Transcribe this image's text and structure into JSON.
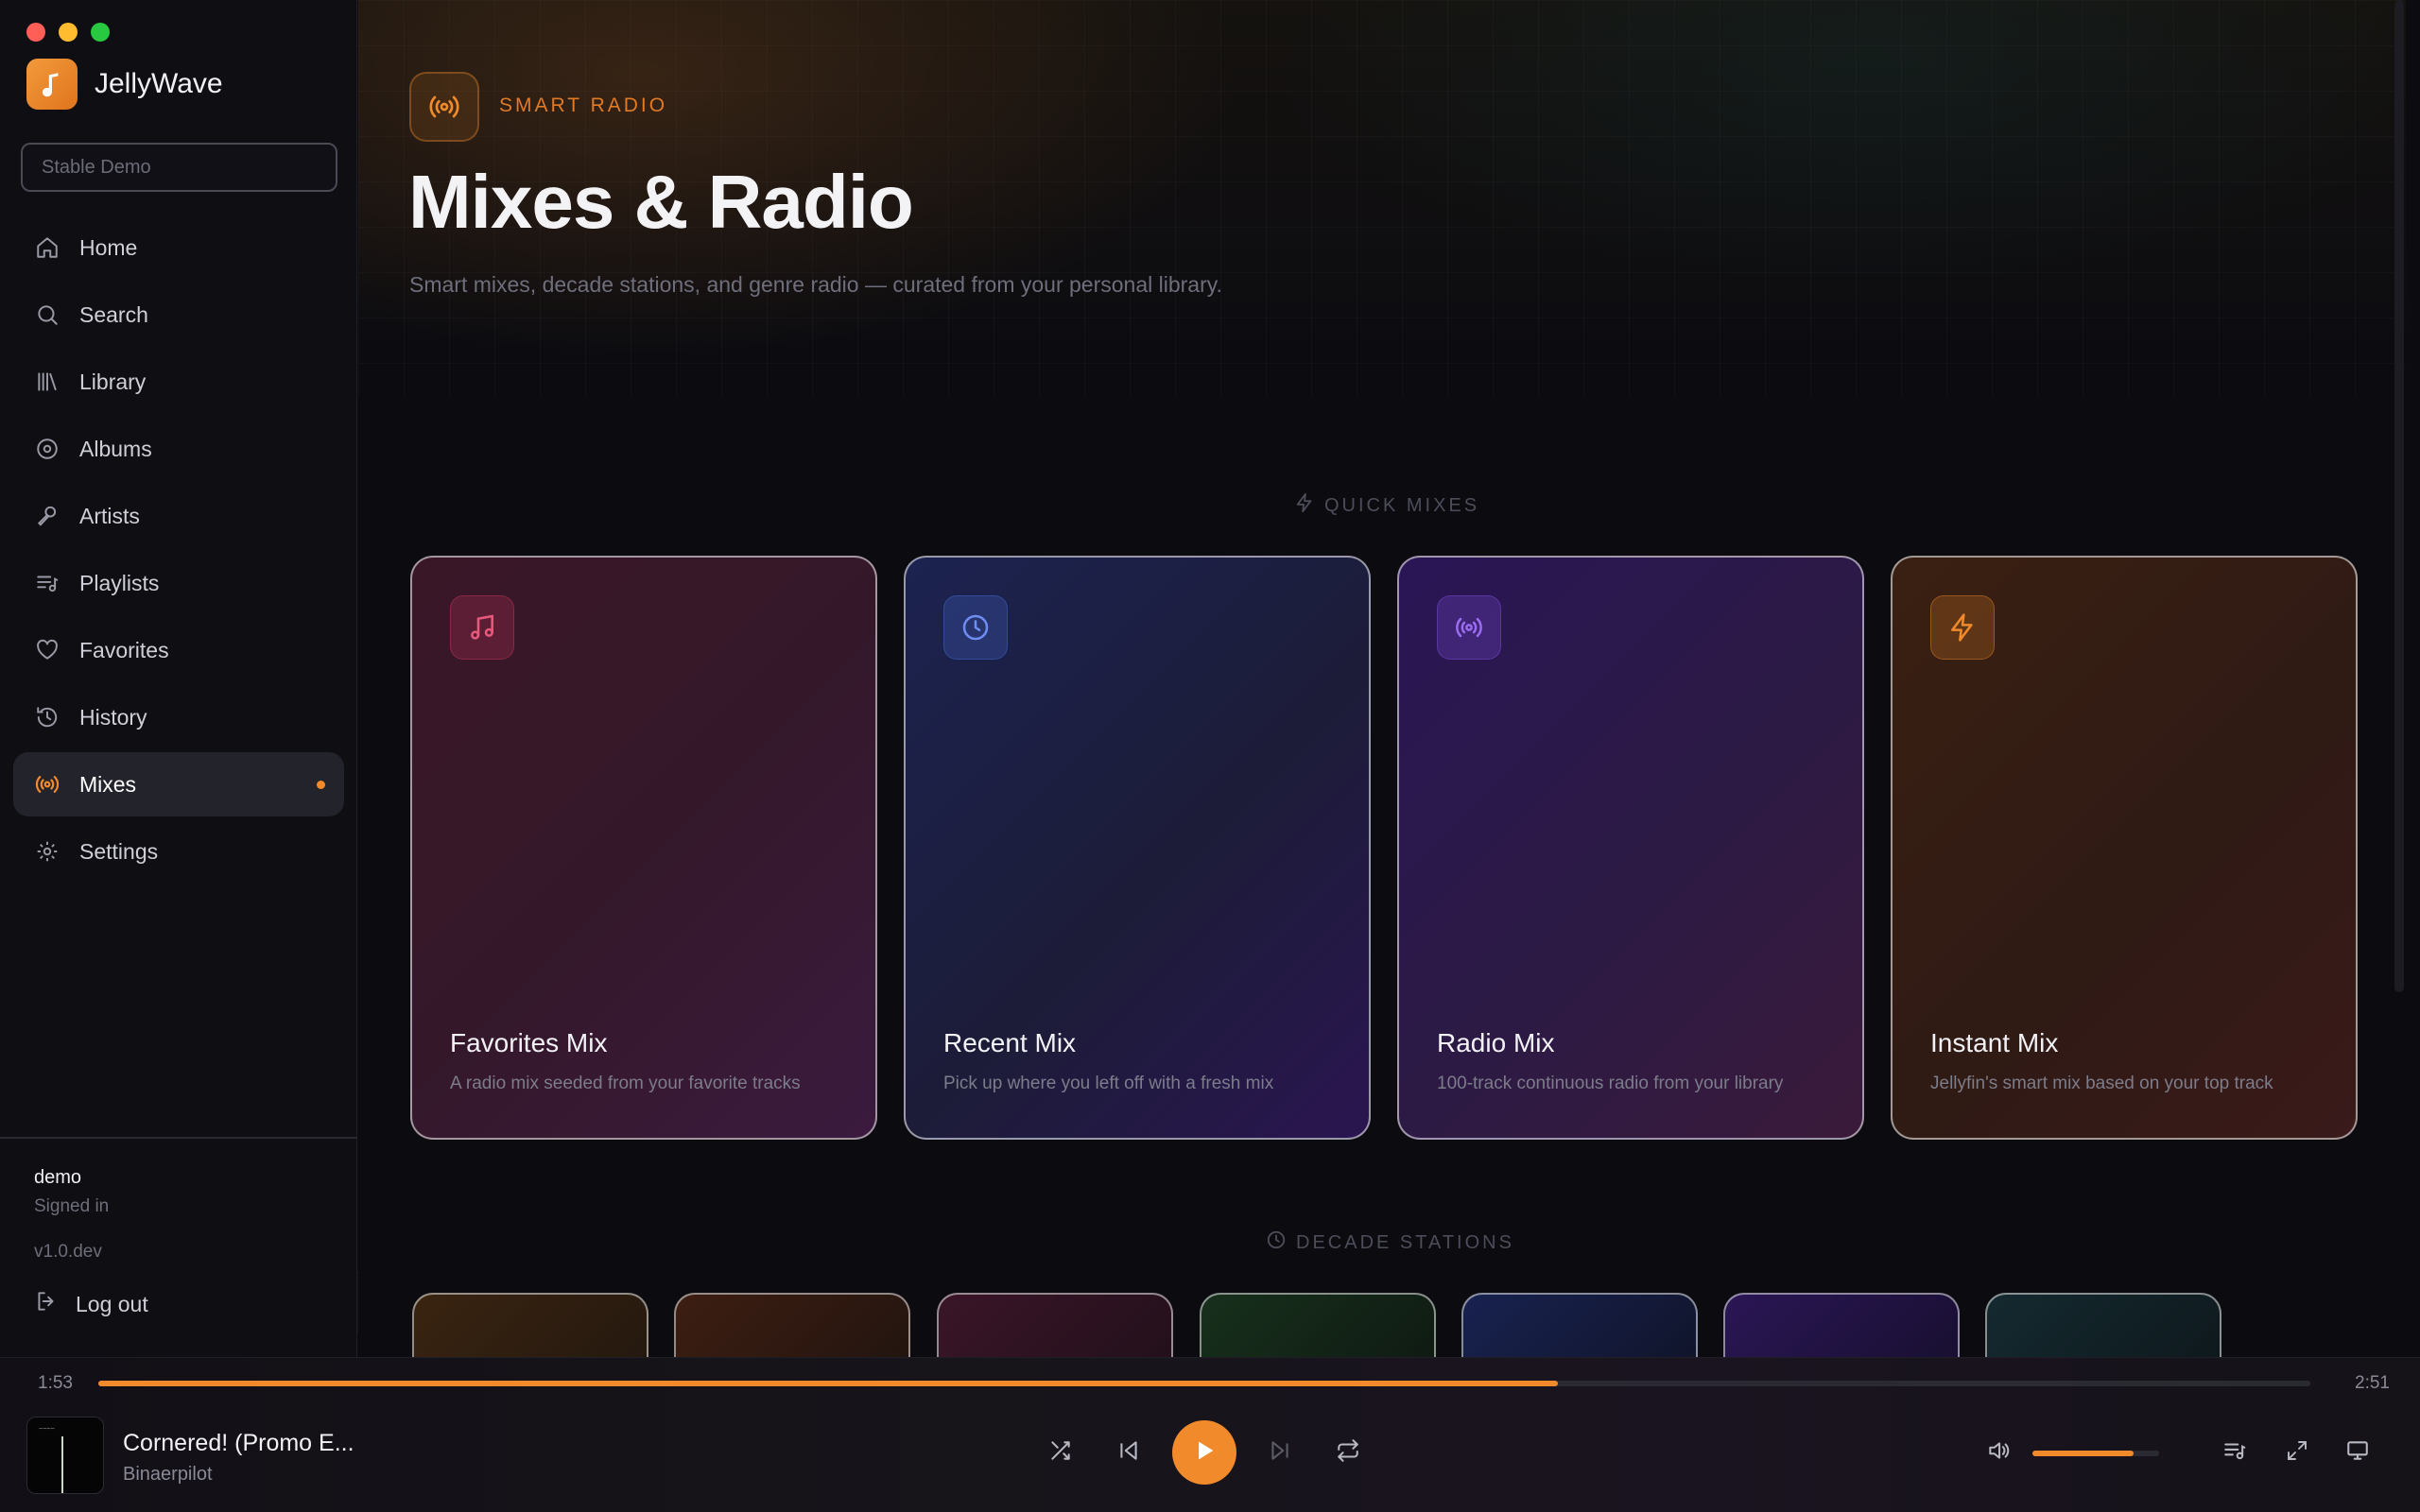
{
  "app": {
    "name": "JellyWave",
    "server": "Stable Demo"
  },
  "sidebar": {
    "items": [
      {
        "label": "Home",
        "icon": "home-icon"
      },
      {
        "label": "Search",
        "icon": "search-icon"
      },
      {
        "label": "Library",
        "icon": "library-icon"
      },
      {
        "label": "Albums",
        "icon": "album-icon"
      },
      {
        "label": "Artists",
        "icon": "microphone-icon"
      },
      {
        "label": "Playlists",
        "icon": "playlist-icon"
      },
      {
        "label": "Favorites",
        "icon": "heart-icon"
      },
      {
        "label": "History",
        "icon": "history-icon"
      },
      {
        "label": "Mixes",
        "icon": "radio-icon",
        "active": true
      },
      {
        "label": "Settings",
        "icon": "gear-icon"
      }
    ],
    "user": {
      "name": "demo",
      "status": "Signed in",
      "version": "v1.0.dev"
    },
    "logout_label": "Log out"
  },
  "hero": {
    "eyebrow": "SMART RADIO",
    "title": "Mixes & Radio",
    "subtitle": "Smart mixes, decade stations, and genre radio — curated from your personal library."
  },
  "sections": {
    "quick_mixes": "QUICK MIXES",
    "decade_stations": "DECADE STATIONS"
  },
  "mixes": [
    {
      "title": "Favorites Mix",
      "desc": "A radio mix seeded from your favorite tracks",
      "icon": "music-note-icon"
    },
    {
      "title": "Recent Mix",
      "desc": "Pick up where you left off with a fresh mix",
      "icon": "clock-icon"
    },
    {
      "title": "Radio Mix",
      "desc": "100-track continuous radio from your library",
      "icon": "radio-icon"
    },
    {
      "title": "Instant Mix",
      "desc": "Jellyfin's smart mix based on your top track",
      "icon": "bolt-icon"
    }
  ],
  "player": {
    "current_time": "1:53",
    "total_time": "2:51",
    "progress": 0.66,
    "track_title": "Cornered! (Promo E...",
    "artist": "Binaerpilot",
    "volume": 0.8
  },
  "colors": {
    "accent": "#f08a2b"
  }
}
